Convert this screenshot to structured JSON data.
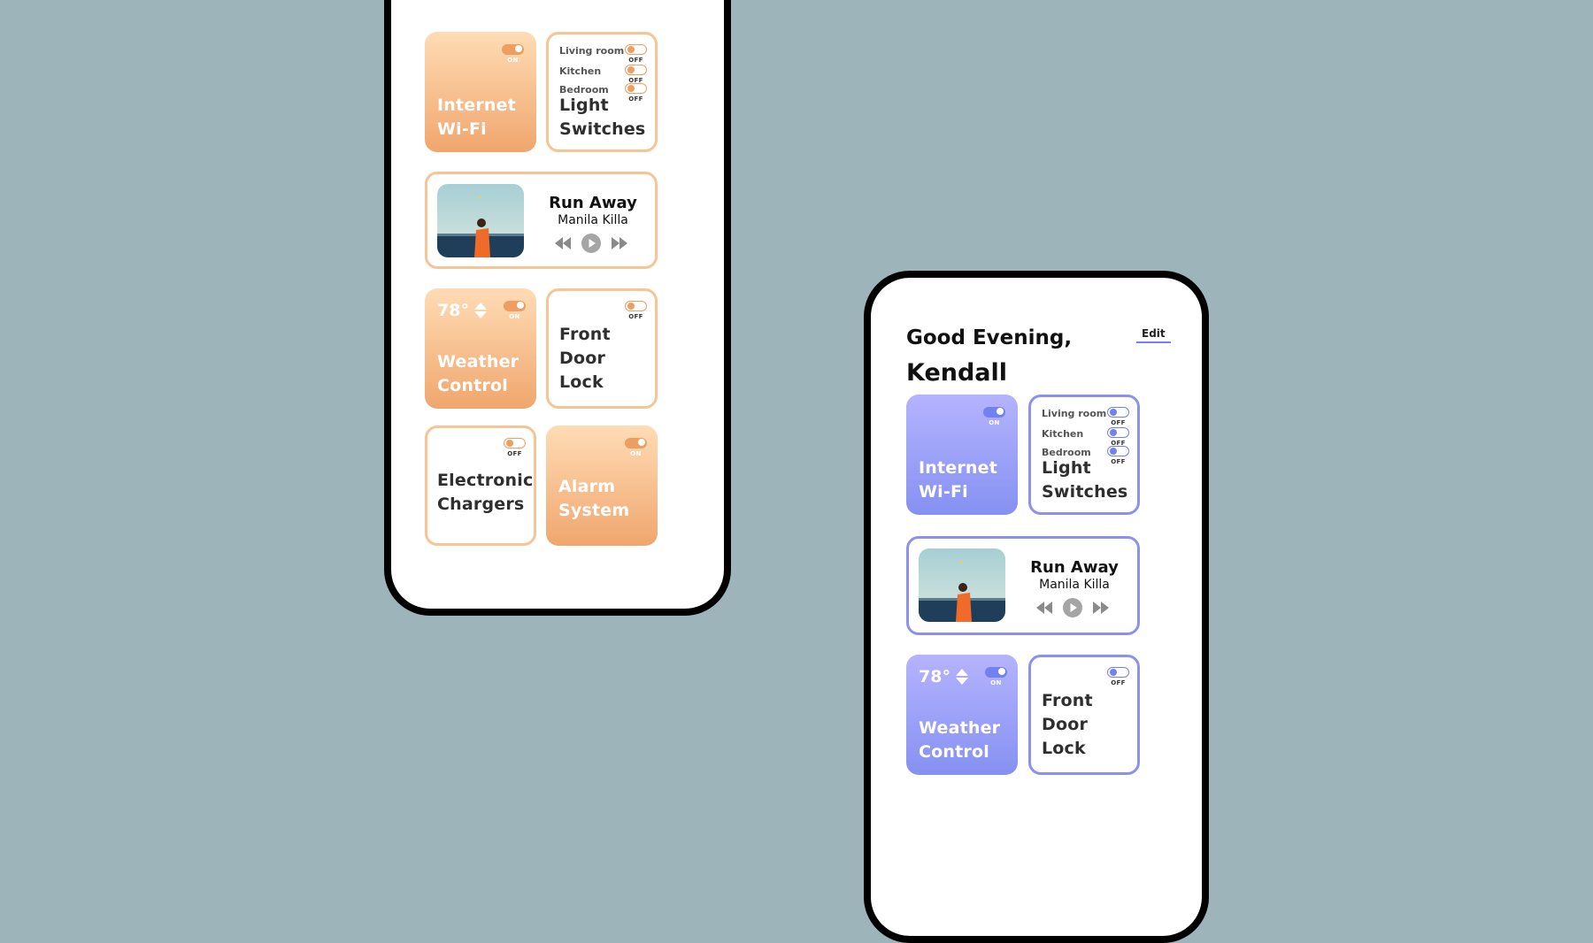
{
  "colors": {
    "background": "#9db5ba",
    "orange_accent": "#ef9e62",
    "purple_accent": "#7380ef"
  },
  "toggle_labels": {
    "on": "ON",
    "off": "OFF"
  },
  "phone_orange": {
    "cards": {
      "wifi": {
        "title_line1": "Internet",
        "title_line2": "Wi-Fi",
        "toggle": "ON"
      },
      "lights": {
        "rooms": [
          {
            "label": "Living room",
            "state": "OFF"
          },
          {
            "label": "Kitchen",
            "state": "OFF"
          },
          {
            "label": "Bedroom",
            "state": "OFF"
          }
        ],
        "title_line1": "Light",
        "title_line2": "Switches"
      },
      "music": {
        "title": "Run Away",
        "artist": "Manila Killa"
      },
      "weather": {
        "temp": "78°",
        "title_line1": "Weather",
        "title_line2": "Control",
        "toggle": "ON"
      },
      "lock": {
        "title_line1": "Front",
        "title_line2": "Door Lock",
        "toggle": "OFF"
      },
      "chargers": {
        "title_line1": "Electronic",
        "title_line2": "Chargers",
        "toggle": "OFF"
      },
      "alarm": {
        "title_line1": "Alarm",
        "title_line2": "System",
        "toggle": "ON"
      }
    }
  },
  "phone_purple": {
    "greeting_line1": "Good Evening,",
    "greeting_line2": "Kendall",
    "edit_label": "Edit",
    "cards": {
      "wifi": {
        "title_line1": "Internet",
        "title_line2": "Wi-Fi",
        "toggle": "ON"
      },
      "lights": {
        "rooms": [
          {
            "label": "Living room",
            "state": "OFF"
          },
          {
            "label": "Kitchen",
            "state": "OFF"
          },
          {
            "label": "Bedroom",
            "state": "OFF"
          }
        ],
        "title_line1": "Light",
        "title_line2": "Switches"
      },
      "music": {
        "title": "Run Away",
        "artist": "Manila Killa"
      },
      "weather": {
        "temp": "78°",
        "title_line1": "Weather",
        "title_line2": "Control",
        "toggle": "ON"
      },
      "lock": {
        "title_line1": "Front",
        "title_line2": "Door Lock",
        "toggle": "OFF"
      }
    }
  }
}
